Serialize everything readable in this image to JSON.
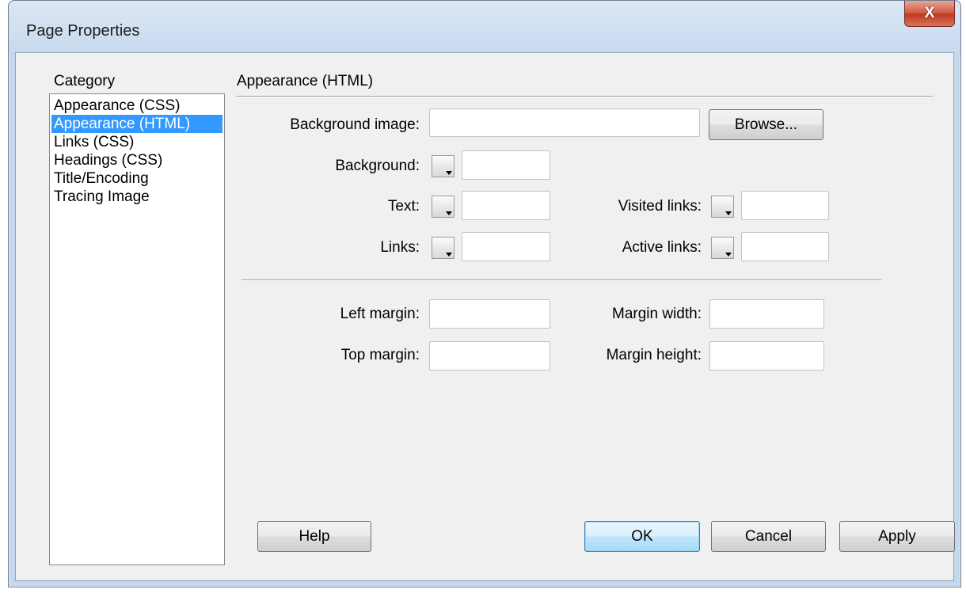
{
  "window": {
    "title": "Page Properties",
    "close_label": "X"
  },
  "category": {
    "heading": "Category",
    "items": [
      {
        "label": "Appearance (CSS)",
        "selected": false
      },
      {
        "label": "Appearance (HTML)",
        "selected": true
      },
      {
        "label": "Links (CSS)",
        "selected": false
      },
      {
        "label": "Headings (CSS)",
        "selected": false
      },
      {
        "label": "Title/Encoding",
        "selected": false
      },
      {
        "label": "Tracing Image",
        "selected": false
      }
    ]
  },
  "panel": {
    "title": "Appearance (HTML)",
    "background_image": {
      "label": "Background image:",
      "value": ""
    },
    "browse_label": "Browse...",
    "background": {
      "label": "Background:",
      "value": ""
    },
    "text": {
      "label": "Text:",
      "value": ""
    },
    "links": {
      "label": "Links:",
      "value": ""
    },
    "visited_links": {
      "label": "Visited links:",
      "value": ""
    },
    "active_links": {
      "label": "Active links:",
      "value": ""
    },
    "left_margin": {
      "label": "Left margin:",
      "value": ""
    },
    "top_margin": {
      "label": "Top margin:",
      "value": ""
    },
    "margin_width": {
      "label": "Margin width:",
      "value": ""
    },
    "margin_height": {
      "label": "Margin height:",
      "value": ""
    }
  },
  "buttons": {
    "help": "Help",
    "ok": "OK",
    "cancel": "Cancel",
    "apply": "Apply"
  },
  "colors": {
    "selection": "#3399ff",
    "window_frame": "#c5d7ec",
    "close_button": "#c0391f"
  }
}
